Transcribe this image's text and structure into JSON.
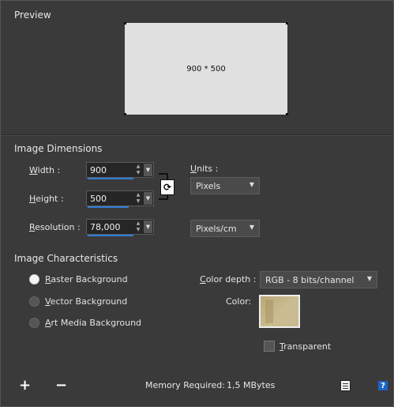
{
  "preview": {
    "title": "Preview",
    "size_text": "900 * 500"
  },
  "dimensions": {
    "title": "Image Dimensions",
    "width": {
      "label_u": "W",
      "label_rest": "idth :",
      "value": "900"
    },
    "height": {
      "label_u": "H",
      "label_rest": "eight :",
      "value": "500"
    },
    "resolution": {
      "label_u": "R",
      "label_rest": "esolution :",
      "value": "78,000"
    },
    "units": {
      "label_u": "U",
      "label_rest": "nits :",
      "value": "Pixels"
    },
    "resolution_units": {
      "value": "Pixels/cm"
    }
  },
  "characteristics": {
    "title": "Image Characteristics",
    "backgrounds": [
      {
        "label_u": "R",
        "label_rest": "aster Background",
        "selected": true
      },
      {
        "label_u": "V",
        "label_rest": "ector Background",
        "selected": false
      },
      {
        "label_u": "A",
        "label_rest": "rt Media Background",
        "selected": false
      }
    ],
    "color_depth": {
      "label_u": "C",
      "label_rest": "olor depth :",
      "value": "RGB - 8 bits/channel"
    },
    "color": {
      "label": "Color:",
      "swatch_hex": "#c3b487"
    },
    "transparent": {
      "label_u": "T",
      "label_rest": "ransparent",
      "checked": false
    }
  },
  "footer": {
    "add_symbol": "+",
    "remove_symbol": "−",
    "memory_label": "Memory Required:",
    "memory_value": "1,5 MBytes",
    "help_symbol": "?"
  },
  "colors": {
    "background": "#3a3a3a",
    "field": "#262626",
    "accent": "#2f7fd6",
    "preview": "#e0e0e0"
  }
}
